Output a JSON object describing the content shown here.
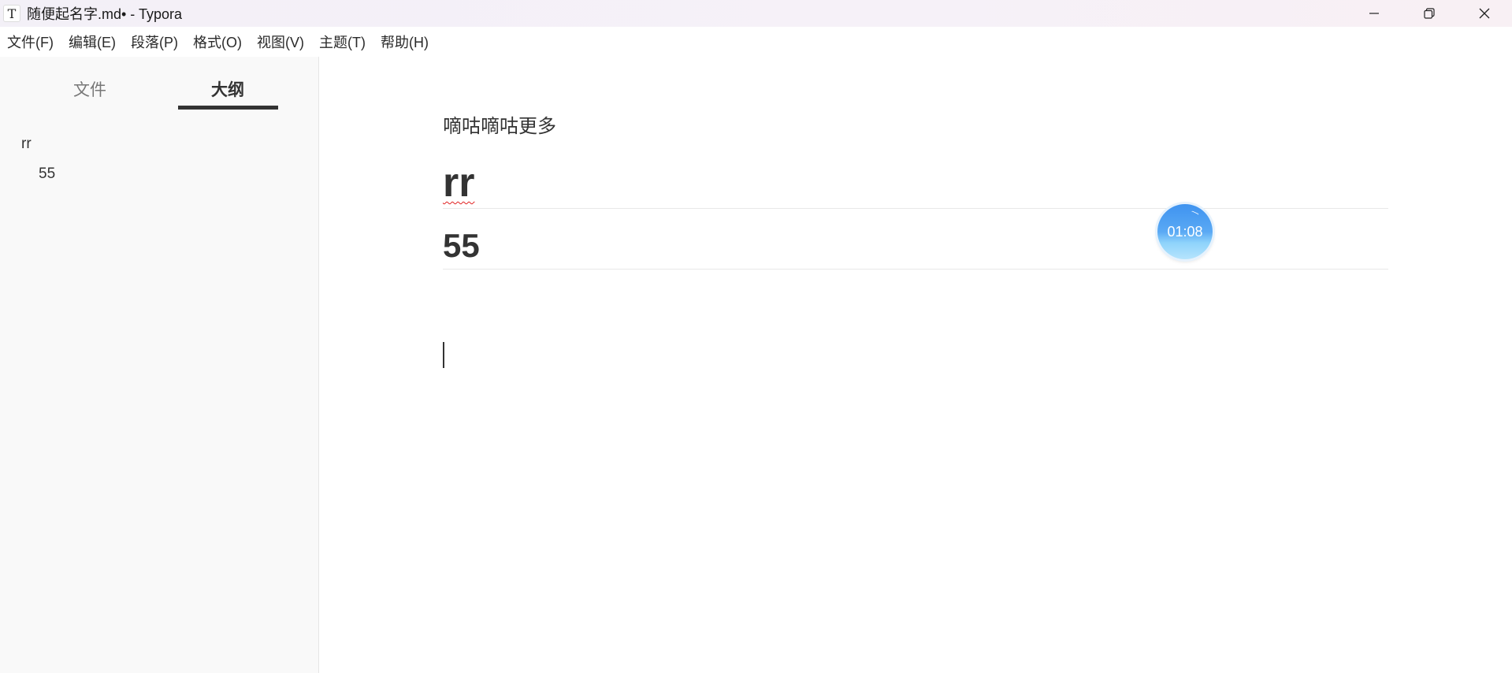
{
  "window": {
    "app_icon_glyph": "T",
    "title": "随便起名字.md• - Typora",
    "controls": {
      "minimize": "minimize-icon",
      "restore": "restore-icon",
      "close": "close-icon"
    }
  },
  "menu": {
    "items": [
      "文件(F)",
      "编辑(E)",
      "段落(P)",
      "格式(O)",
      "视图(V)",
      "主题(T)",
      "帮助(H)"
    ]
  },
  "sidebar": {
    "tabs": [
      {
        "label": "文件",
        "active": false
      },
      {
        "label": "大纲",
        "active": true
      }
    ],
    "outline": [
      {
        "label": "rr",
        "level": 1
      },
      {
        "label": "55",
        "level": 2
      }
    ]
  },
  "document": {
    "paragraph": "嘀咕嘀咕更多",
    "heading1": "rr",
    "heading2": "55"
  },
  "timer": {
    "text": "01:08"
  },
  "colors": {
    "accent_tab_underline": "#333333",
    "spellcheck": "#e02020",
    "timer_blue": "#3f93f0"
  }
}
